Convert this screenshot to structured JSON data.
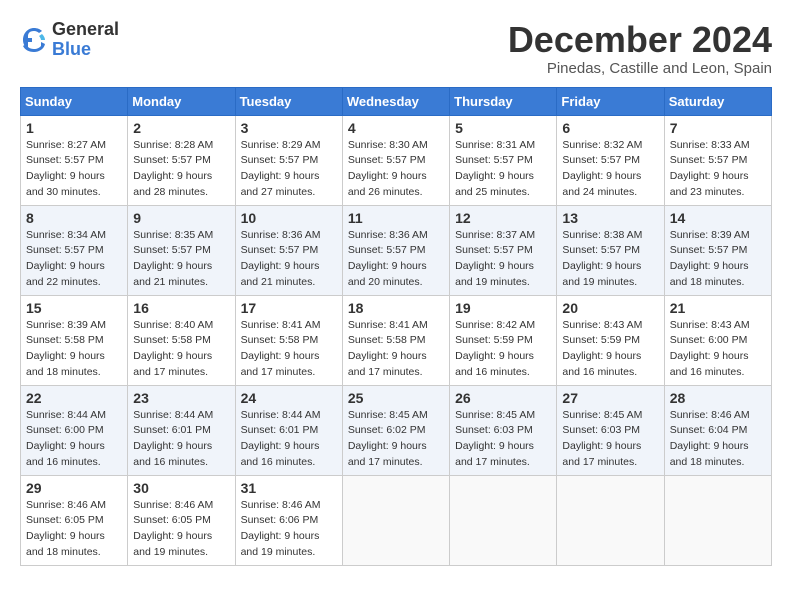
{
  "logo": {
    "general": "General",
    "blue": "Blue"
  },
  "title": "December 2024",
  "subtitle": "Pinedas, Castille and Leon, Spain",
  "weekdays": [
    "Sunday",
    "Monday",
    "Tuesday",
    "Wednesday",
    "Thursday",
    "Friday",
    "Saturday"
  ],
  "weeks": [
    [
      {
        "day": "1",
        "sunrise": "Sunrise: 8:27 AM",
        "sunset": "Sunset: 5:57 PM",
        "daylight": "Daylight: 9 hours and 30 minutes."
      },
      {
        "day": "2",
        "sunrise": "Sunrise: 8:28 AM",
        "sunset": "Sunset: 5:57 PM",
        "daylight": "Daylight: 9 hours and 28 minutes."
      },
      {
        "day": "3",
        "sunrise": "Sunrise: 8:29 AM",
        "sunset": "Sunset: 5:57 PM",
        "daylight": "Daylight: 9 hours and 27 minutes."
      },
      {
        "day": "4",
        "sunrise": "Sunrise: 8:30 AM",
        "sunset": "Sunset: 5:57 PM",
        "daylight": "Daylight: 9 hours and 26 minutes."
      },
      {
        "day": "5",
        "sunrise": "Sunrise: 8:31 AM",
        "sunset": "Sunset: 5:57 PM",
        "daylight": "Daylight: 9 hours and 25 minutes."
      },
      {
        "day": "6",
        "sunrise": "Sunrise: 8:32 AM",
        "sunset": "Sunset: 5:57 PM",
        "daylight": "Daylight: 9 hours and 24 minutes."
      },
      {
        "day": "7",
        "sunrise": "Sunrise: 8:33 AM",
        "sunset": "Sunset: 5:57 PM",
        "daylight": "Daylight: 9 hours and 23 minutes."
      }
    ],
    [
      {
        "day": "8",
        "sunrise": "Sunrise: 8:34 AM",
        "sunset": "Sunset: 5:57 PM",
        "daylight": "Daylight: 9 hours and 22 minutes."
      },
      {
        "day": "9",
        "sunrise": "Sunrise: 8:35 AM",
        "sunset": "Sunset: 5:57 PM",
        "daylight": "Daylight: 9 hours and 21 minutes."
      },
      {
        "day": "10",
        "sunrise": "Sunrise: 8:36 AM",
        "sunset": "Sunset: 5:57 PM",
        "daylight": "Daylight: 9 hours and 21 minutes."
      },
      {
        "day": "11",
        "sunrise": "Sunrise: 8:36 AM",
        "sunset": "Sunset: 5:57 PM",
        "daylight": "Daylight: 9 hours and 20 minutes."
      },
      {
        "day": "12",
        "sunrise": "Sunrise: 8:37 AM",
        "sunset": "Sunset: 5:57 PM",
        "daylight": "Daylight: 9 hours and 19 minutes."
      },
      {
        "day": "13",
        "sunrise": "Sunrise: 8:38 AM",
        "sunset": "Sunset: 5:57 PM",
        "daylight": "Daylight: 9 hours and 19 minutes."
      },
      {
        "day": "14",
        "sunrise": "Sunrise: 8:39 AM",
        "sunset": "Sunset: 5:57 PM",
        "daylight": "Daylight: 9 hours and 18 minutes."
      }
    ],
    [
      {
        "day": "15",
        "sunrise": "Sunrise: 8:39 AM",
        "sunset": "Sunset: 5:58 PM",
        "daylight": "Daylight: 9 hours and 18 minutes."
      },
      {
        "day": "16",
        "sunrise": "Sunrise: 8:40 AM",
        "sunset": "Sunset: 5:58 PM",
        "daylight": "Daylight: 9 hours and 17 minutes."
      },
      {
        "day": "17",
        "sunrise": "Sunrise: 8:41 AM",
        "sunset": "Sunset: 5:58 PM",
        "daylight": "Daylight: 9 hours and 17 minutes."
      },
      {
        "day": "18",
        "sunrise": "Sunrise: 8:41 AM",
        "sunset": "Sunset: 5:58 PM",
        "daylight": "Daylight: 9 hours and 17 minutes."
      },
      {
        "day": "19",
        "sunrise": "Sunrise: 8:42 AM",
        "sunset": "Sunset: 5:59 PM",
        "daylight": "Daylight: 9 hours and 16 minutes."
      },
      {
        "day": "20",
        "sunrise": "Sunrise: 8:43 AM",
        "sunset": "Sunset: 5:59 PM",
        "daylight": "Daylight: 9 hours and 16 minutes."
      },
      {
        "day": "21",
        "sunrise": "Sunrise: 8:43 AM",
        "sunset": "Sunset: 6:00 PM",
        "daylight": "Daylight: 9 hours and 16 minutes."
      }
    ],
    [
      {
        "day": "22",
        "sunrise": "Sunrise: 8:44 AM",
        "sunset": "Sunset: 6:00 PM",
        "daylight": "Daylight: 9 hours and 16 minutes."
      },
      {
        "day": "23",
        "sunrise": "Sunrise: 8:44 AM",
        "sunset": "Sunset: 6:01 PM",
        "daylight": "Daylight: 9 hours and 16 minutes."
      },
      {
        "day": "24",
        "sunrise": "Sunrise: 8:44 AM",
        "sunset": "Sunset: 6:01 PM",
        "daylight": "Daylight: 9 hours and 16 minutes."
      },
      {
        "day": "25",
        "sunrise": "Sunrise: 8:45 AM",
        "sunset": "Sunset: 6:02 PM",
        "daylight": "Daylight: 9 hours and 17 minutes."
      },
      {
        "day": "26",
        "sunrise": "Sunrise: 8:45 AM",
        "sunset": "Sunset: 6:03 PM",
        "daylight": "Daylight: 9 hours and 17 minutes."
      },
      {
        "day": "27",
        "sunrise": "Sunrise: 8:45 AM",
        "sunset": "Sunset: 6:03 PM",
        "daylight": "Daylight: 9 hours and 17 minutes."
      },
      {
        "day": "28",
        "sunrise": "Sunrise: 8:46 AM",
        "sunset": "Sunset: 6:04 PM",
        "daylight": "Daylight: 9 hours and 18 minutes."
      }
    ],
    [
      {
        "day": "29",
        "sunrise": "Sunrise: 8:46 AM",
        "sunset": "Sunset: 6:05 PM",
        "daylight": "Daylight: 9 hours and 18 minutes."
      },
      {
        "day": "30",
        "sunrise": "Sunrise: 8:46 AM",
        "sunset": "Sunset: 6:05 PM",
        "daylight": "Daylight: 9 hours and 19 minutes."
      },
      {
        "day": "31",
        "sunrise": "Sunrise: 8:46 AM",
        "sunset": "Sunset: 6:06 PM",
        "daylight": "Daylight: 9 hours and 19 minutes."
      },
      null,
      null,
      null,
      null
    ]
  ]
}
